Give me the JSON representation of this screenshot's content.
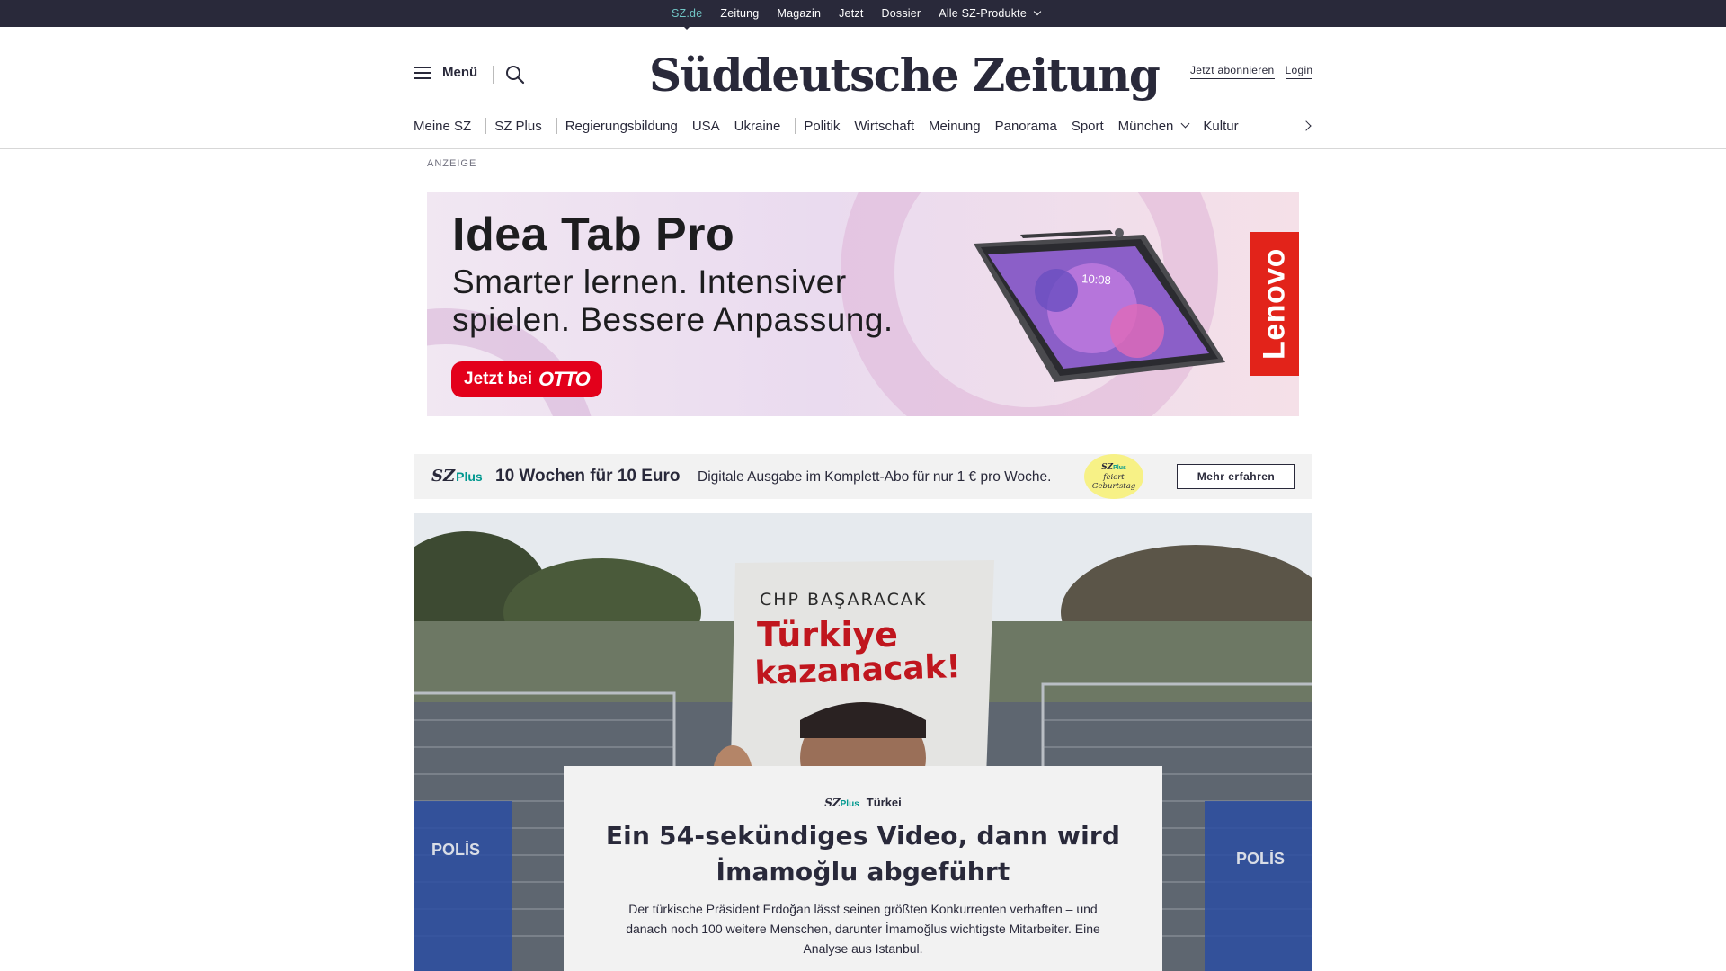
{
  "topbar": {
    "items": [
      {
        "label": "SZ.de",
        "active": true
      },
      {
        "label": "Zeitung"
      },
      {
        "label": "Magazin"
      },
      {
        "label": "Jetzt"
      },
      {
        "label": "Dossier"
      },
      {
        "label": "Alle SZ-Produkte",
        "has_dropdown": true
      }
    ]
  },
  "header": {
    "menu_label": "Menü",
    "logo_text": "Süddeutsche Zeitung",
    "subscribe_label": "Jetzt abonnieren",
    "login_label": "Login"
  },
  "mainnav": {
    "items": [
      "Meine SZ",
      "SZ Plus",
      "Regierungsbildung",
      "USA",
      "Ukraine",
      "Politik",
      "Wirtschaft",
      "Meinung",
      "Panorama",
      "Sport",
      "München",
      "Kultur"
    ]
  },
  "ad": {
    "label": "ANZEIGE",
    "title": "Idea Tab Pro",
    "subtitle_line1": "Smarter lernen. Intensiver",
    "subtitle_line2": "spielen. Bessere Anpassung.",
    "cta_prefix": "Jetzt bei",
    "cta_brand": "OTTO",
    "brand": "Lenovo",
    "tablet_time": "10:08",
    "accent": "#e3001b"
  },
  "promo": {
    "logo": "SZ",
    "logo_plus": "Plus",
    "headline": "10 Wochen für 10 Euro",
    "text": "Digitale Ausgabe im Komplett-Abo für nur 1 € pro Woche.",
    "badge_logo": "SZ",
    "badge_plus": "Plus",
    "badge_line1": "feiert",
    "badge_line2": "Geburtstag",
    "button_label": "Mehr erfahren"
  },
  "hero": {
    "sign_line1": "CHP BAŞARACAK",
    "sign_line2": "Türkiye",
    "sign_line3": "kazanacak!",
    "barrier_text": "POLİS",
    "kicker_logo": "SZ",
    "kicker_plus": "Plus",
    "kicker_topic": "Türkei",
    "title": "Ein 54-sekündiges Video, dann wird İmamoğlu abgeführt",
    "text": "Der türkische Präsident Erdoğan lässt seinen größten Konkurrenten verhaften – und danach noch 100 weitere Menschen, darunter İmamoğlus wichtigste Mitarbeiter. Eine Analyse aus Istanbul."
  }
}
